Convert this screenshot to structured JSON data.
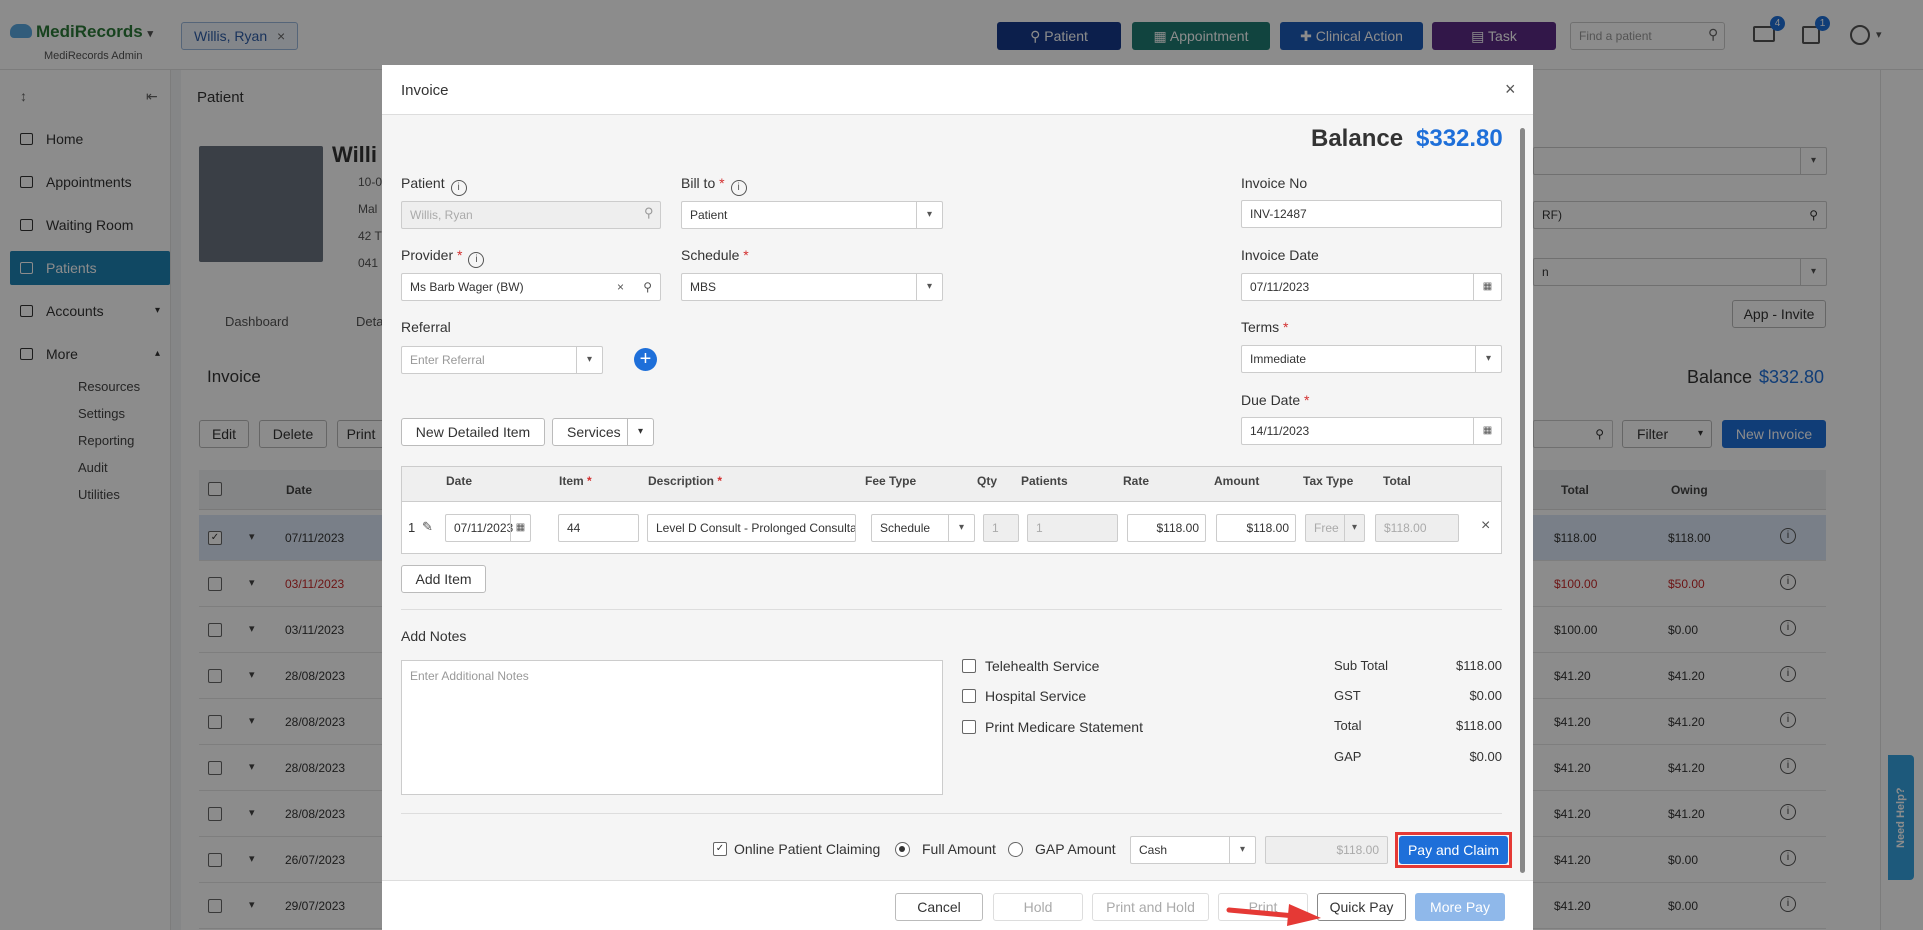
{
  "header": {
    "app_name": "MediRecords",
    "app_sub": "MediRecords Admin",
    "patient_chip": "Willis, Ryan",
    "buttons": [
      {
        "label": "Patient",
        "color": "#173a8a"
      },
      {
        "label": "Appointment",
        "color": "#1f7d74"
      },
      {
        "label": "Clinical Action",
        "color": "#1d5bb8"
      },
      {
        "label": "Task",
        "color": "#5b2a86"
      }
    ],
    "search_placeholder": "Find a patient",
    "mail_badge": "4",
    "task_badge": "1"
  },
  "sidebar": {
    "items": [
      {
        "label": "Home"
      },
      {
        "label": "Appointments"
      },
      {
        "label": "Waiting Room"
      },
      {
        "label": "Patients",
        "active": true
      },
      {
        "label": "Accounts"
      },
      {
        "label": "More"
      }
    ],
    "sub_items": [
      "Resources",
      "Settings",
      "Reporting",
      "Audit",
      "Utilities"
    ]
  },
  "background": {
    "page_title": "Patient",
    "patient_name_partial": "Willi",
    "info_lines": [
      "10-0",
      "Mal",
      "42 T",
      "041"
    ],
    "tabs": [
      "Dashboard",
      "Deta"
    ],
    "section_title": "Invoice",
    "actions": [
      "Edit",
      "Delete",
      "Print"
    ],
    "filter_label": "Filter",
    "new_invoice_label": "New Invoice",
    "balance_label": "Balance",
    "balance_value": "$332.80",
    "app_invite": "App - Invite",
    "field_partial": "RF)",
    "field_partial2": "n",
    "columns": {
      "date": "Date",
      "total": "Total",
      "owing": "Owing"
    },
    "rows": [
      {
        "date": "07/11/2023",
        "total": "$118.00",
        "owing": "$118.00",
        "selected": true
      },
      {
        "date": "03/11/2023",
        "total": "$100.00",
        "owing": "$50.00",
        "red": true
      },
      {
        "date": "03/11/2023",
        "total": "$100.00",
        "owing": "$0.00"
      },
      {
        "date": "28/08/2023",
        "total": "$41.20",
        "owing": "$41.20"
      },
      {
        "date": "28/08/2023",
        "total": "$41.20",
        "owing": "$41.20"
      },
      {
        "date": "28/08/2023",
        "total": "$41.20",
        "owing": "$41.20"
      },
      {
        "date": "28/08/2023",
        "total": "$41.20",
        "owing": "$41.20"
      },
      {
        "date": "26/07/2023",
        "total": "$41.20",
        "owing": "$0.00"
      },
      {
        "date": "29/07/2023",
        "total": "$41.20",
        "owing": "$0.00"
      }
    ],
    "need_help": "Need Help?"
  },
  "modal": {
    "title": "Invoice",
    "balance_label": "Balance",
    "balance_value": "$332.80",
    "patient_label": "Patient",
    "patient_value": "Willis, Ryan",
    "bill_to_label": "Bill to",
    "bill_to_value": "Patient",
    "provider_label": "Provider",
    "provider_value": "Ms Barb Wager (BW)",
    "schedule_label": "Schedule",
    "schedule_value": "MBS",
    "referral_label": "Referral",
    "referral_placeholder": "Enter Referral",
    "invoice_no_label": "Invoice No",
    "invoice_no_value": "INV-12487",
    "invoice_date_label": "Invoice Date",
    "invoice_date_value": "07/11/2023",
    "terms_label": "Terms",
    "terms_value": "Immediate",
    "due_date_label": "Due Date",
    "due_date_value": "14/11/2023",
    "new_detailed_item": "New Detailed Item",
    "services_label": "Services",
    "table_headers": {
      "date": "Date",
      "item": "Item",
      "description": "Description",
      "fee_type": "Fee Type",
      "qty": "Qty",
      "patients": "Patients",
      "rate": "Rate",
      "amount": "Amount",
      "tax_type": "Tax Type",
      "total": "Total"
    },
    "line": {
      "num": "1",
      "date": "07/11/2023",
      "item": "44",
      "description": "Level D Consult - Prolonged Consultat...",
      "fee_type": "Schedule",
      "qty": "1",
      "patients": "1",
      "rate": "$118.00",
      "amount": "$118.00",
      "tax_type": "Free",
      "total": "$118.00"
    },
    "add_item": "Add Item",
    "add_notes_label": "Add Notes",
    "notes_placeholder": "Enter Additional Notes",
    "checks": [
      "Telehealth Service",
      "Hospital Service",
      "Print Medicare Statement"
    ],
    "summary": [
      {
        "label": "Sub Total",
        "value": "$118.00"
      },
      {
        "label": "GST",
        "value": "$0.00"
      },
      {
        "label": "Total",
        "value": "$118.00"
      },
      {
        "label": "GAP",
        "value": "$0.00"
      }
    ],
    "online_claiming": "Online Patient Claiming",
    "full_amount": "Full Amount",
    "gap_amount": "GAP Amount",
    "payment_method": "Cash",
    "pay_amount": "$118.00",
    "pay_and_claim": "Pay and Claim",
    "footer": {
      "cancel": "Cancel",
      "hold": "Hold",
      "print_hold": "Print and Hold",
      "print": "Print",
      "quick_pay": "Quick Pay",
      "more_pay": "More Pay"
    }
  }
}
